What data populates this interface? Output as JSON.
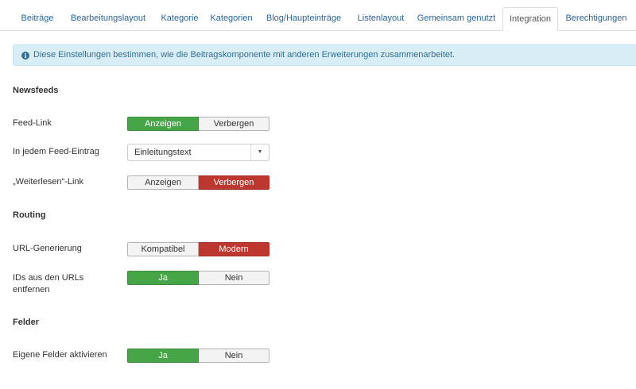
{
  "tabs": [
    {
      "label": "Beiträge"
    },
    {
      "label": "Bearbeitungslayout"
    },
    {
      "label": "Kategorie"
    },
    {
      "label": "Kategorien"
    },
    {
      "label": "Blog/Haupteinträge"
    },
    {
      "label": "Listenlayout"
    },
    {
      "label": "Gemeinsam genutzt"
    },
    {
      "label": "Integration"
    },
    {
      "label": "Berechtigungen"
    }
  ],
  "active_tab": "Integration",
  "alert": {
    "icon": "info-icon",
    "text": "Diese Einstellungen bestimmen, wie die Beitragskomponente mit anderen Erweiterungen zusammenarbeitet."
  },
  "sections": {
    "newsfeeds": {
      "title": "Newsfeeds",
      "feed_link": {
        "label": "Feed-Link",
        "options": [
          "Anzeigen",
          "Verbergen"
        ],
        "selected": "Anzeigen"
      },
      "feed_entry": {
        "label": "In jedem Feed-Eintrag",
        "value": "Einleitungstext"
      },
      "readmore": {
        "label": "„Weiterlesen“-Link",
        "options": [
          "Anzeigen",
          "Verbergen"
        ],
        "selected": "Verbergen"
      }
    },
    "routing": {
      "title": "Routing",
      "url_gen": {
        "label": "URL-Generierung",
        "options": [
          "Kompatibel",
          "Modern"
        ],
        "selected": "Modern"
      },
      "remove_ids": {
        "label": "IDs aus den URLs entfernen",
        "options": [
          "Ja",
          "Nein"
        ],
        "selected": "Ja"
      }
    },
    "fields": {
      "title": "Felder",
      "custom_fields": {
        "label": "Eigene Felder aktivieren",
        "options": [
          "Ja",
          "Nein"
        ],
        "selected": "Ja"
      }
    }
  },
  "colors": {
    "selected_green": "#46a546",
    "selected_red": "#bd362f",
    "alert_bg": "#d9edf7",
    "link": "#2a6496"
  }
}
